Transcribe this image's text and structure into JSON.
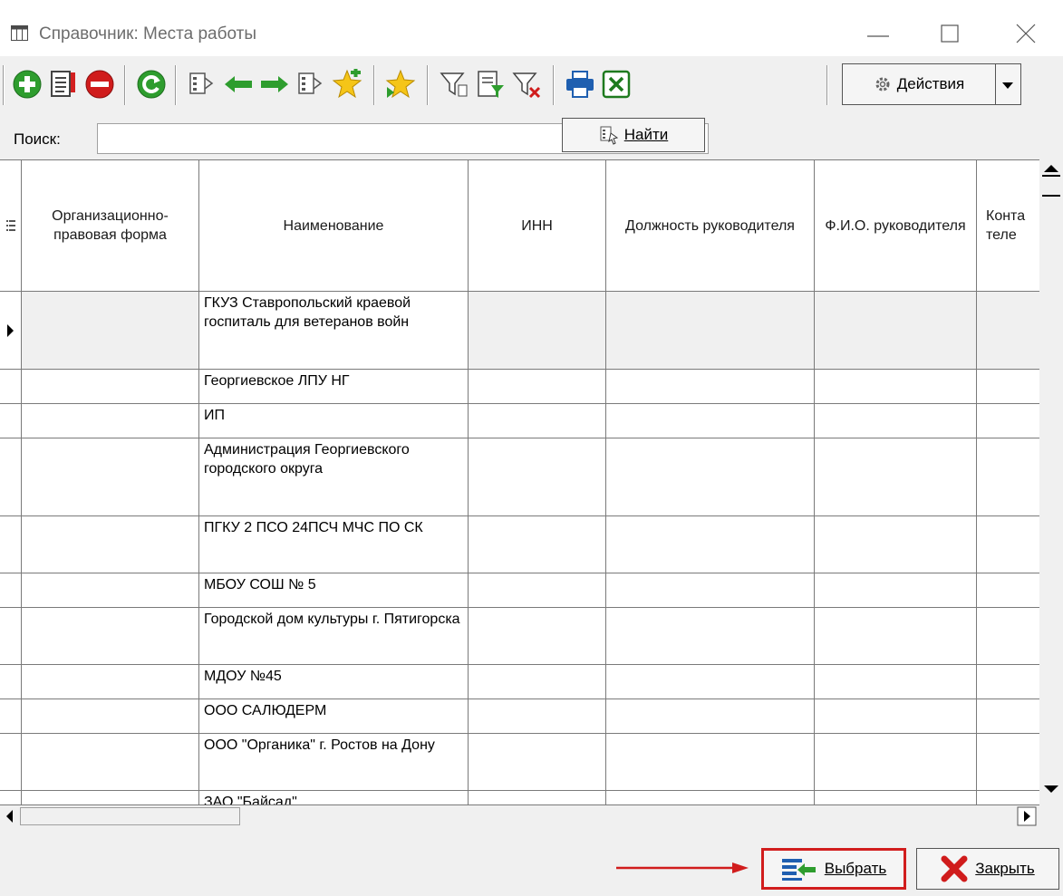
{
  "window": {
    "title": "Справочник: Места работы"
  },
  "toolbar": {
    "actions_label": "Действия"
  },
  "search": {
    "label": "Поиск:",
    "value": "",
    "find_label": "Найти"
  },
  "columns": [
    {
      "key": "org_form",
      "label": "Организационно-правовая форма"
    },
    {
      "key": "name",
      "label": "Наименование"
    },
    {
      "key": "inn",
      "label": "ИНН"
    },
    {
      "key": "head_position",
      "label": "Должность руководителя"
    },
    {
      "key": "head_fio",
      "label": "Ф.И.О. руководителя"
    },
    {
      "key": "contact_phone",
      "label": "Конта теле"
    }
  ],
  "rows": [
    {
      "name": "ГКУЗ Ставропольский краевой госпиталь для ветеранов войн",
      "selected": true
    },
    {
      "name": "Георгиевское ЛПУ НГ"
    },
    {
      "name": "ИП"
    },
    {
      "name": "Администрация Георгиевского городского округа"
    },
    {
      "name": "ПГКУ 2 ПСО 24ПСЧ МЧС ПО СК"
    },
    {
      "name": "МБОУ СОШ № 5"
    },
    {
      "name": "Городской дом культуры г. Пятигорска"
    },
    {
      "name": "МДОУ №45"
    },
    {
      "name": "ООО САЛЮДЕРМ"
    },
    {
      "name": "ООО \"Органика\" г. Ростов на Дону"
    },
    {
      "name": "ЗАО \"Байсад\""
    }
  ],
  "footer": {
    "choose_label": "Выбрать",
    "close_label": "Закрыть"
  },
  "colors": {
    "highlight_border": "#d11d1d",
    "arrow": "#d11d1d"
  }
}
